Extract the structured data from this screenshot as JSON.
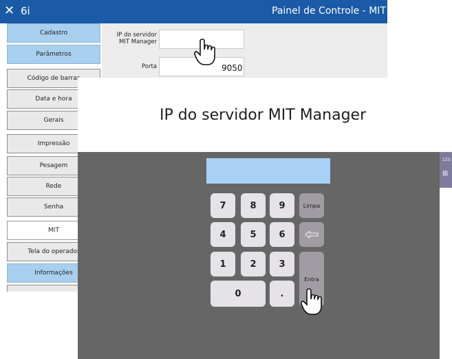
{
  "titlebar": {
    "close_glyph": "✕",
    "app_name": "6i",
    "title": "Painel de Controle - MIT"
  },
  "sidebar": {
    "items": [
      {
        "label": "Cadastro"
      },
      {
        "label": "Parâmetros"
      },
      {
        "label": "Código de barras"
      },
      {
        "label": "Data e hora"
      },
      {
        "label": "Gerais"
      },
      {
        "label": "Impressão"
      },
      {
        "label": "Pesagem"
      },
      {
        "label": "Rede"
      },
      {
        "label": "Senha"
      },
      {
        "label": "MIT"
      },
      {
        "label": "Tela do operador"
      },
      {
        "label": "Informações"
      }
    ]
  },
  "form": {
    "server_ip_label_line1": "IP do servidor",
    "server_ip_label_line2": "MIT Manager",
    "server_ip_value": "",
    "port_label": "Porta",
    "port_value": "9050"
  },
  "keypad": {
    "prompt": "IP do servidor MIT Manager",
    "display_value": "",
    "keys": {
      "k7": "7",
      "k8": "8",
      "k9": "9",
      "k4": "4",
      "k5": "5",
      "k6": "6",
      "k1": "1",
      "k2": "2",
      "k3": "3",
      "k0": "0",
      "dot": ".",
      "clear": "Limpa",
      "enter": "Entra"
    },
    "backspace_icon": "arrow-left-outline-icon"
  },
  "side_tab": {
    "line1": "123",
    "line2": "⊞"
  },
  "colors": {
    "titlebar": "#1b5aa6",
    "nav_selected_blue": "#a9cfee",
    "nav_gray": "#e9e9e9",
    "keypad_bg": "#666666",
    "keypad_display": "#a9d0f5",
    "key_light": "#e6e3e8",
    "key_dark": "#a19ca4"
  }
}
